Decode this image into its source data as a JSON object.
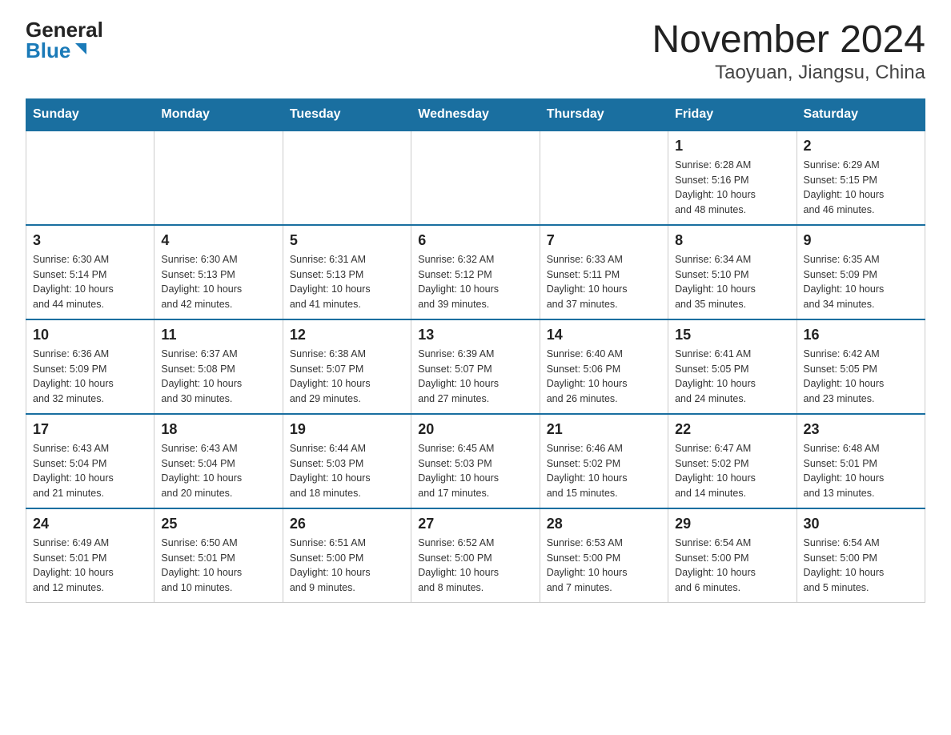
{
  "header": {
    "logo_general": "General",
    "logo_blue": "Blue",
    "title": "November 2024",
    "subtitle": "Taoyuan, Jiangsu, China"
  },
  "weekdays": [
    "Sunday",
    "Monday",
    "Tuesday",
    "Wednesday",
    "Thursday",
    "Friday",
    "Saturday"
  ],
  "weeks": [
    [
      {
        "day": "",
        "info": ""
      },
      {
        "day": "",
        "info": ""
      },
      {
        "day": "",
        "info": ""
      },
      {
        "day": "",
        "info": ""
      },
      {
        "day": "",
        "info": ""
      },
      {
        "day": "1",
        "info": "Sunrise: 6:28 AM\nSunset: 5:16 PM\nDaylight: 10 hours\nand 48 minutes."
      },
      {
        "day": "2",
        "info": "Sunrise: 6:29 AM\nSunset: 5:15 PM\nDaylight: 10 hours\nand 46 minutes."
      }
    ],
    [
      {
        "day": "3",
        "info": "Sunrise: 6:30 AM\nSunset: 5:14 PM\nDaylight: 10 hours\nand 44 minutes."
      },
      {
        "day": "4",
        "info": "Sunrise: 6:30 AM\nSunset: 5:13 PM\nDaylight: 10 hours\nand 42 minutes."
      },
      {
        "day": "5",
        "info": "Sunrise: 6:31 AM\nSunset: 5:13 PM\nDaylight: 10 hours\nand 41 minutes."
      },
      {
        "day": "6",
        "info": "Sunrise: 6:32 AM\nSunset: 5:12 PM\nDaylight: 10 hours\nand 39 minutes."
      },
      {
        "day": "7",
        "info": "Sunrise: 6:33 AM\nSunset: 5:11 PM\nDaylight: 10 hours\nand 37 minutes."
      },
      {
        "day": "8",
        "info": "Sunrise: 6:34 AM\nSunset: 5:10 PM\nDaylight: 10 hours\nand 35 minutes."
      },
      {
        "day": "9",
        "info": "Sunrise: 6:35 AM\nSunset: 5:09 PM\nDaylight: 10 hours\nand 34 minutes."
      }
    ],
    [
      {
        "day": "10",
        "info": "Sunrise: 6:36 AM\nSunset: 5:09 PM\nDaylight: 10 hours\nand 32 minutes."
      },
      {
        "day": "11",
        "info": "Sunrise: 6:37 AM\nSunset: 5:08 PM\nDaylight: 10 hours\nand 30 minutes."
      },
      {
        "day": "12",
        "info": "Sunrise: 6:38 AM\nSunset: 5:07 PM\nDaylight: 10 hours\nand 29 minutes."
      },
      {
        "day": "13",
        "info": "Sunrise: 6:39 AM\nSunset: 5:07 PM\nDaylight: 10 hours\nand 27 minutes."
      },
      {
        "day": "14",
        "info": "Sunrise: 6:40 AM\nSunset: 5:06 PM\nDaylight: 10 hours\nand 26 minutes."
      },
      {
        "day": "15",
        "info": "Sunrise: 6:41 AM\nSunset: 5:05 PM\nDaylight: 10 hours\nand 24 minutes."
      },
      {
        "day": "16",
        "info": "Sunrise: 6:42 AM\nSunset: 5:05 PM\nDaylight: 10 hours\nand 23 minutes."
      }
    ],
    [
      {
        "day": "17",
        "info": "Sunrise: 6:43 AM\nSunset: 5:04 PM\nDaylight: 10 hours\nand 21 minutes."
      },
      {
        "day": "18",
        "info": "Sunrise: 6:43 AM\nSunset: 5:04 PM\nDaylight: 10 hours\nand 20 minutes."
      },
      {
        "day": "19",
        "info": "Sunrise: 6:44 AM\nSunset: 5:03 PM\nDaylight: 10 hours\nand 18 minutes."
      },
      {
        "day": "20",
        "info": "Sunrise: 6:45 AM\nSunset: 5:03 PM\nDaylight: 10 hours\nand 17 minutes."
      },
      {
        "day": "21",
        "info": "Sunrise: 6:46 AM\nSunset: 5:02 PM\nDaylight: 10 hours\nand 15 minutes."
      },
      {
        "day": "22",
        "info": "Sunrise: 6:47 AM\nSunset: 5:02 PM\nDaylight: 10 hours\nand 14 minutes."
      },
      {
        "day": "23",
        "info": "Sunrise: 6:48 AM\nSunset: 5:01 PM\nDaylight: 10 hours\nand 13 minutes."
      }
    ],
    [
      {
        "day": "24",
        "info": "Sunrise: 6:49 AM\nSunset: 5:01 PM\nDaylight: 10 hours\nand 12 minutes."
      },
      {
        "day": "25",
        "info": "Sunrise: 6:50 AM\nSunset: 5:01 PM\nDaylight: 10 hours\nand 10 minutes."
      },
      {
        "day": "26",
        "info": "Sunrise: 6:51 AM\nSunset: 5:00 PM\nDaylight: 10 hours\nand 9 minutes."
      },
      {
        "day": "27",
        "info": "Sunrise: 6:52 AM\nSunset: 5:00 PM\nDaylight: 10 hours\nand 8 minutes."
      },
      {
        "day": "28",
        "info": "Sunrise: 6:53 AM\nSunset: 5:00 PM\nDaylight: 10 hours\nand 7 minutes."
      },
      {
        "day": "29",
        "info": "Sunrise: 6:54 AM\nSunset: 5:00 PM\nDaylight: 10 hours\nand 6 minutes."
      },
      {
        "day": "30",
        "info": "Sunrise: 6:54 AM\nSunset: 5:00 PM\nDaylight: 10 hours\nand 5 minutes."
      }
    ]
  ]
}
